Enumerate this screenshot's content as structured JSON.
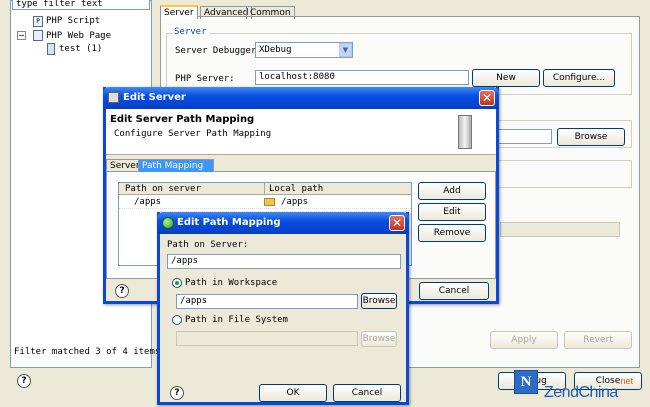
{
  "tree": {
    "filter_placeholder": "type filter text",
    "items": [
      {
        "label": "PHP Script"
      },
      {
        "label": "PHP Web Page"
      },
      {
        "label": "test (1)"
      }
    ],
    "status": "Filter matched 3 of 4 items"
  },
  "main": {
    "tabs": [
      "Server",
      "Advanced",
      "Common"
    ],
    "group_label": "Server",
    "debugger_label": "Server Debugger:",
    "debugger_value": "XDebug",
    "php_server_label": "PHP Server:",
    "php_server_value": "localhost:8080",
    "new_button": "New",
    "configure_button": "Configure...",
    "browse_button": "Browse",
    "apply_button": "Apply",
    "revert_button": "Revert",
    "debug_button": "Debug",
    "close_button": "Close"
  },
  "edit_server": {
    "title": "Edit Server",
    "heading": "Edit Server Path Mapping",
    "description": "Configure Server Path Mapping",
    "tabs": [
      "Server",
      "Path Mapping"
    ],
    "columns": [
      "Path on server",
      "Local path"
    ],
    "rows": [
      {
        "server": "/apps",
        "local": "/apps"
      }
    ],
    "add_button": "Add",
    "edit_button": "Edit",
    "remove_button": "Remove",
    "cancel_button": "Cancel"
  },
  "edit_path": {
    "title": "Edit Path Mapping",
    "path_label": "Path on Server:",
    "path_value": "/apps",
    "workspace_radio": "Path in Workspace",
    "workspace_value": "/apps",
    "browse_button": "Browse",
    "filesystem_radio": "Path in File System",
    "browse_disabled_button": "Browse",
    "ok_button": "OK",
    "cancel_button": "Cancel"
  },
  "watermark": {
    "brand_zend": "Zend",
    "brand_china": "China",
    "brand_net": ".net"
  },
  "colors": {
    "title_bar": "#0a4ee0",
    "selected_tab": "#3d95ff",
    "close_button": "#c0341e"
  }
}
